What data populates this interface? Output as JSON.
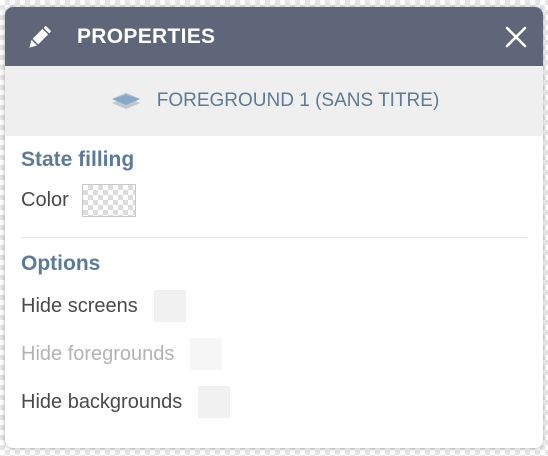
{
  "header": {
    "title": "PROPERTIES",
    "edit_icon": "pencil-icon",
    "close_icon": "close-icon",
    "background_color": "#5f6679"
  },
  "object": {
    "icon": "layer-icon",
    "label": "FOREGROUND 1 (SANS TITRE)"
  },
  "state_filling": {
    "title": "State filling",
    "color_label": "Color",
    "color_value": "transparent"
  },
  "options": {
    "title": "Options",
    "items": [
      {
        "label": "Hide screens",
        "enabled": true,
        "checked": false
      },
      {
        "label": "Hide foregrounds",
        "enabled": false,
        "checked": false
      },
      {
        "label": "Hide backgrounds",
        "enabled": true,
        "checked": false
      }
    ]
  },
  "colors": {
    "accent_text": "#5d7a96",
    "header_bg": "#5f6679",
    "object_bar_bg": "#efefef"
  }
}
